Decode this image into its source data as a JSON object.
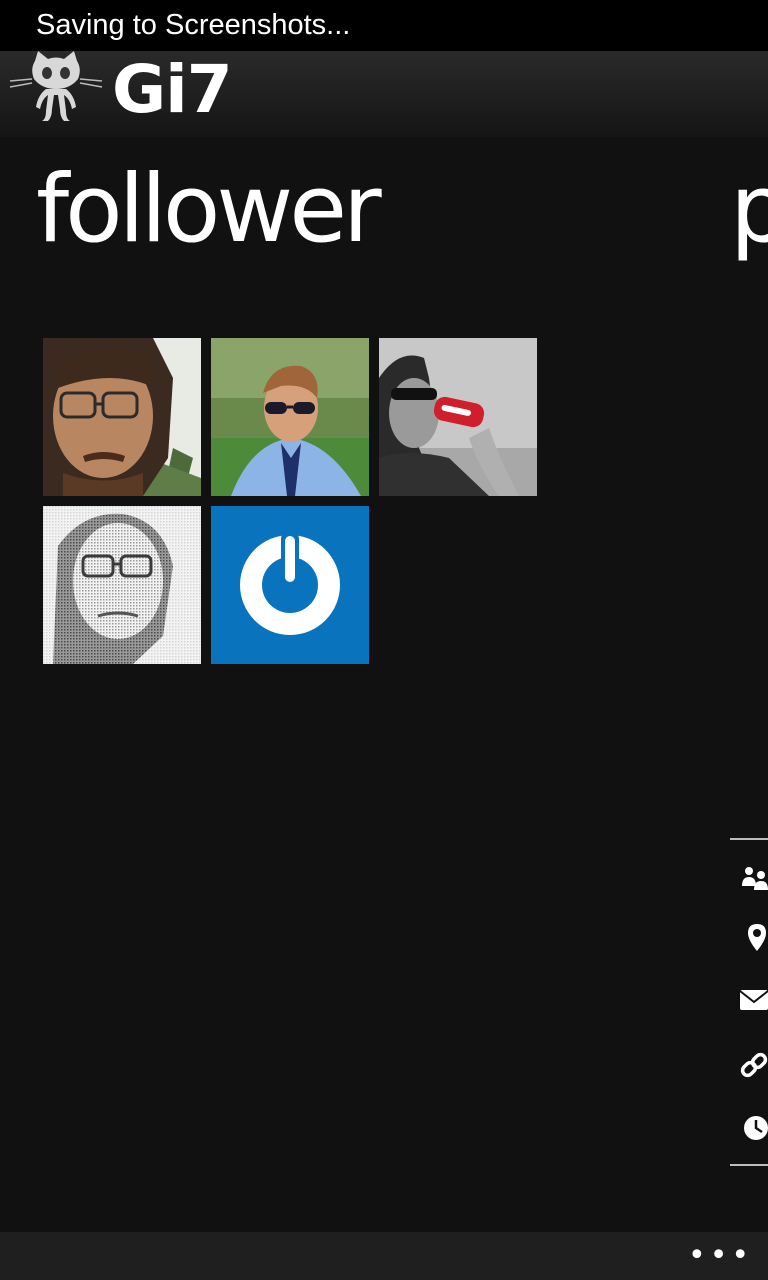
{
  "status_bar": {
    "text": "Saving to Screenshots..."
  },
  "app": {
    "title": "Gi7",
    "logo_icon": "octocat-icon"
  },
  "pivot": {
    "current_title": "follower",
    "next_title_peek": "p"
  },
  "followers": [
    {
      "avatar": "photo-man-glasses-beard"
    },
    {
      "avatar": "photo-man-sunglasses-blue-shirt"
    },
    {
      "avatar": "photo-man-drinking-cola"
    },
    {
      "avatar": "photo-man-dithered-glasses"
    },
    {
      "avatar": "logo-power-icon-blue"
    }
  ],
  "profile_side_icons": [
    "people-icon",
    "location-pin-icon",
    "mail-icon",
    "link-icon",
    "clock-icon"
  ],
  "app_bar": {
    "more_label": "•••"
  },
  "colors": {
    "background": "#111111",
    "accent": "#0a73bd",
    "text": "#ffffff"
  }
}
